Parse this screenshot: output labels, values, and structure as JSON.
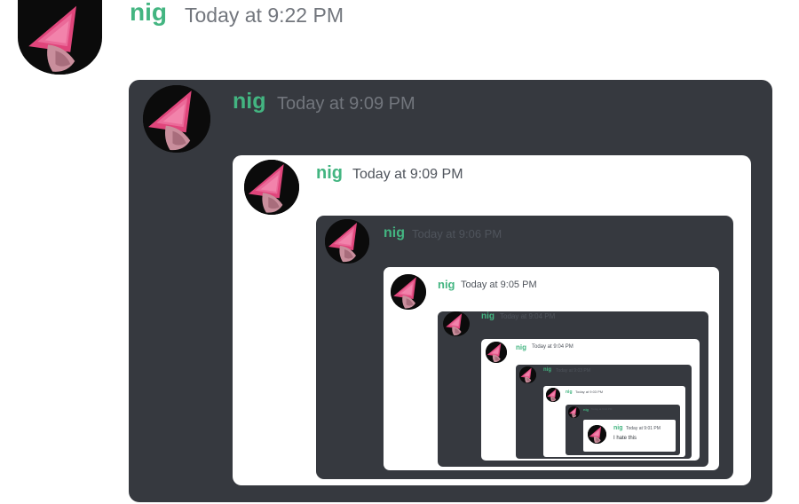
{
  "colors": {
    "username": "#43b581",
    "dark_panel": "#36393f",
    "light_panel": "#ffffff",
    "timestamp": "#72767d"
  },
  "messages": [
    {
      "author": "nig",
      "timestamp": "Today at 9:22 PM"
    },
    {
      "author": "nig",
      "timestamp": "Today at 9:09 PM"
    },
    {
      "author": "nig",
      "timestamp": "Today at 9:09 PM"
    },
    {
      "author": "nig",
      "timestamp": "Today at 9:06 PM"
    },
    {
      "author": "nig",
      "timestamp": "Today at 9:05 PM"
    },
    {
      "author": "nig",
      "timestamp": "Today at 9:04 PM"
    },
    {
      "author": "nig",
      "timestamp": "Today at 9:04 PM"
    },
    {
      "author": "nig",
      "timestamp": "Today at 9:03 PM"
    },
    {
      "author": "nig",
      "timestamp": "Today at 9:03 PM"
    },
    {
      "author": "nig",
      "timestamp": "Today at 9:02 PM"
    },
    {
      "author": "nig",
      "timestamp": "Today at 9:01 PM",
      "text": "I hate this"
    }
  ]
}
